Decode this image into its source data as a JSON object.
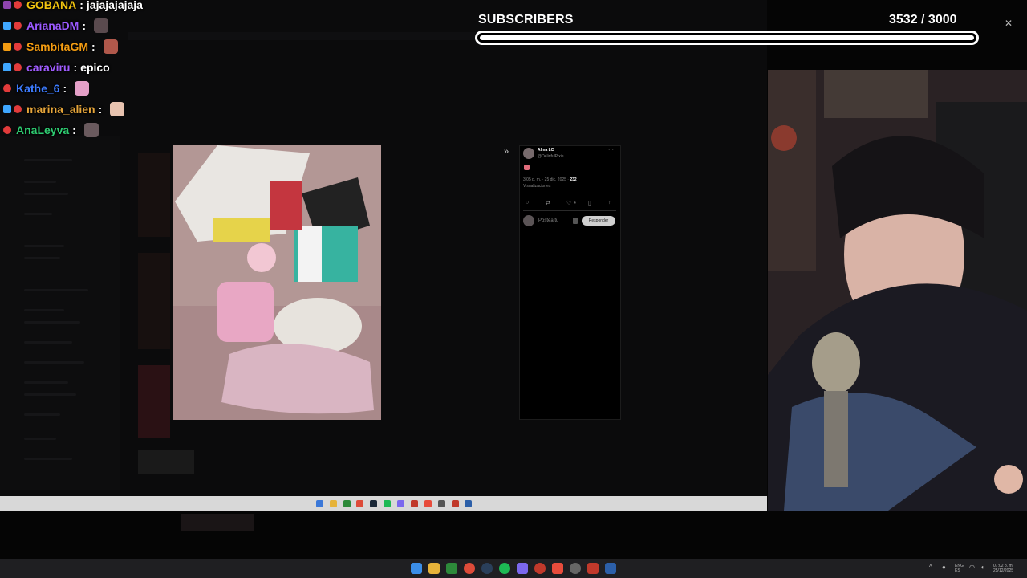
{
  "chat": [
    {
      "user": "GOBANA",
      "message": "jajajajajaja",
      "color": "#f1c40f"
    },
    {
      "user": "ArianaDM",
      "message": "",
      "color": "#9b59ff"
    },
    {
      "user": "SambitaGM",
      "message": "",
      "color": "#f39c12"
    },
    {
      "user": "caraviru",
      "message": "epico",
      "color": "#a05cff"
    },
    {
      "user": "Kathe_6",
      "message": "",
      "color": "#3d7cff"
    },
    {
      "user": "marina_alien",
      "message": "",
      "color": "#e6a53a"
    },
    {
      "user": "AnaLeyva",
      "message": "",
      "color": "#2ecc71"
    }
  ],
  "subscribers": {
    "label": "SUBSCRIBERS",
    "current": "3532",
    "goal": " / 3000",
    "progress": 1.0
  },
  "tweet": {
    "author": "Alma LC",
    "handle": "@DelirifulPixie",
    "timestamp": "3:05 p. m. · 25 dic. 2025 · ",
    "views_count": "232",
    "views_label": "Visualizaciones",
    "likes": "4",
    "reply_placeholder": "Postea tu",
    "reply_button": "Responder"
  },
  "clock": {
    "time": "07:02 p. m.",
    "date": "25/12/2025",
    "lang": "ENG",
    "layout": "ES"
  },
  "colors": {
    "accent_white": "#ffffff",
    "background": "#050505",
    "taskbar": "#1f1f22"
  },
  "icons": {
    "expand": "double-chevron-right-icon",
    "reply": "speech-bubble-icon",
    "repost": "repost-icon",
    "like": "heart-icon",
    "bookmark": "bookmark-icon",
    "share": "share-icon"
  }
}
